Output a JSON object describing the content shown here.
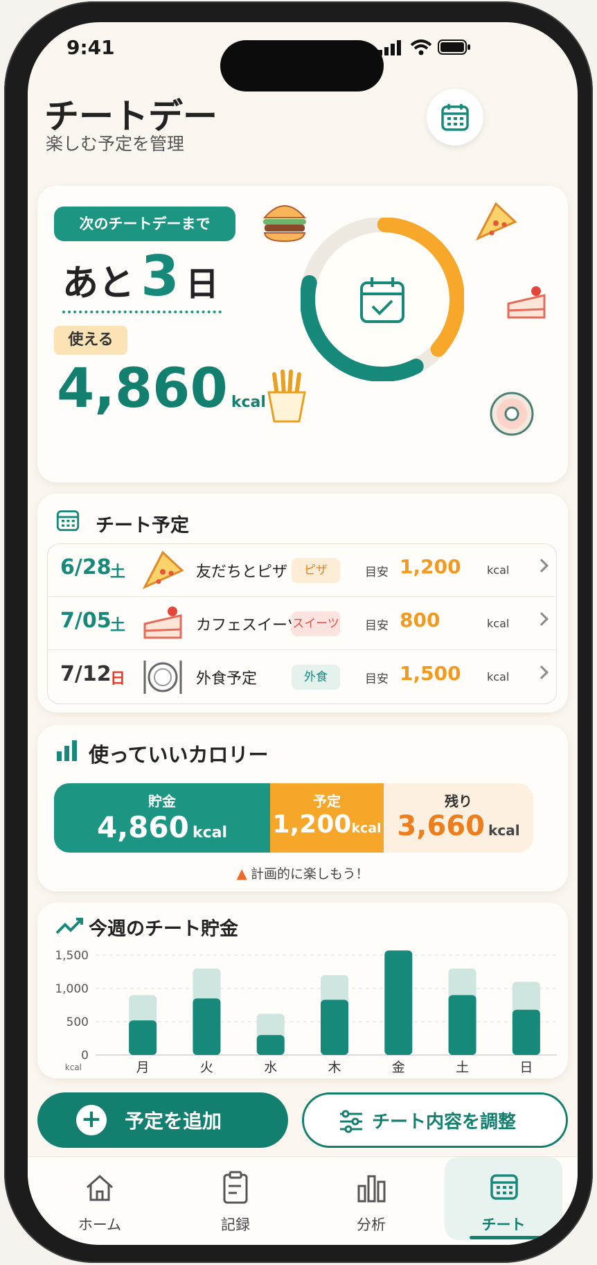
{
  "status": {
    "time": "9:41"
  },
  "header": {
    "title": "チートデー",
    "subtitle": "楽しむ予定を管理"
  },
  "countdown": {
    "badge": "次のチートデーまで",
    "prefix": "あと",
    "days": "3",
    "unit": "日",
    "usable_label": "使える",
    "usable_value": "4,860",
    "usable_unit": "kcal",
    "ring_progress": 0.72
  },
  "schedule": {
    "title": "チート予定",
    "items": [
      {
        "date": "6/28",
        "dow": "土",
        "name": "友だちとピザ",
        "tag": "ピザ",
        "meyasu": "目安",
        "kcal": "1,200",
        "unit": "kcal",
        "food_icon": "pizza-icon"
      },
      {
        "date": "7/05",
        "dow": "土",
        "name": "カフェスイーツ",
        "tag": "スイーツ",
        "meyasu": "目安",
        "kcal": "800",
        "unit": "kcal",
        "food_icon": "cake-icon"
      },
      {
        "date": "7/12",
        "dow": "日",
        "name": "外食予定",
        "tag": "外食",
        "meyasu": "目安",
        "kcal": "1,500",
        "unit": "kcal",
        "food_icon": "plate-icon"
      }
    ]
  },
  "calories": {
    "title": "使っていいカロリー",
    "saving_label": "貯金",
    "saving_value": "4,860",
    "saving_unit": "kcal",
    "planned_label": "予定",
    "planned_value": "1,200",
    "planned_unit": "kcal",
    "remaining_label": "残り",
    "remaining_value": "3,660",
    "remaining_unit": "kcal",
    "note": "計画的に楽しもう！"
  },
  "weekly": {
    "title": "今週のチート貯金",
    "yticks": [
      "1,500",
      "1,000",
      "500",
      "0"
    ],
    "yunit": "kcal"
  },
  "chart_data": {
    "type": "bar",
    "title": "今週のチート貯金",
    "categories": [
      "月",
      "火",
      "水",
      "木",
      "金",
      "土",
      "日"
    ],
    "ylim": [
      0,
      1500
    ],
    "ylabel": "kcal",
    "series": [
      {
        "values": [
          520,
          850,
          300,
          830,
          1570,
          900,
          680
        ]
      },
      {
        "values": [
          900,
          1300,
          620,
          1200,
          1570,
          1300,
          1100
        ]
      }
    ]
  },
  "actions": {
    "add": "予定を追加",
    "adjust": "チート内容を調整"
  },
  "tabs": [
    {
      "label": "ホーム",
      "icon": "home-icon"
    },
    {
      "label": "記録",
      "icon": "clipboard-icon"
    },
    {
      "label": "分析",
      "icon": "bar-chart-icon"
    },
    {
      "label": "チート",
      "icon": "calendar-icon"
    }
  ],
  "colors": {
    "teal": "#16897a",
    "orange": "#f29a1f",
    "bg": "#fbf7f0"
  }
}
